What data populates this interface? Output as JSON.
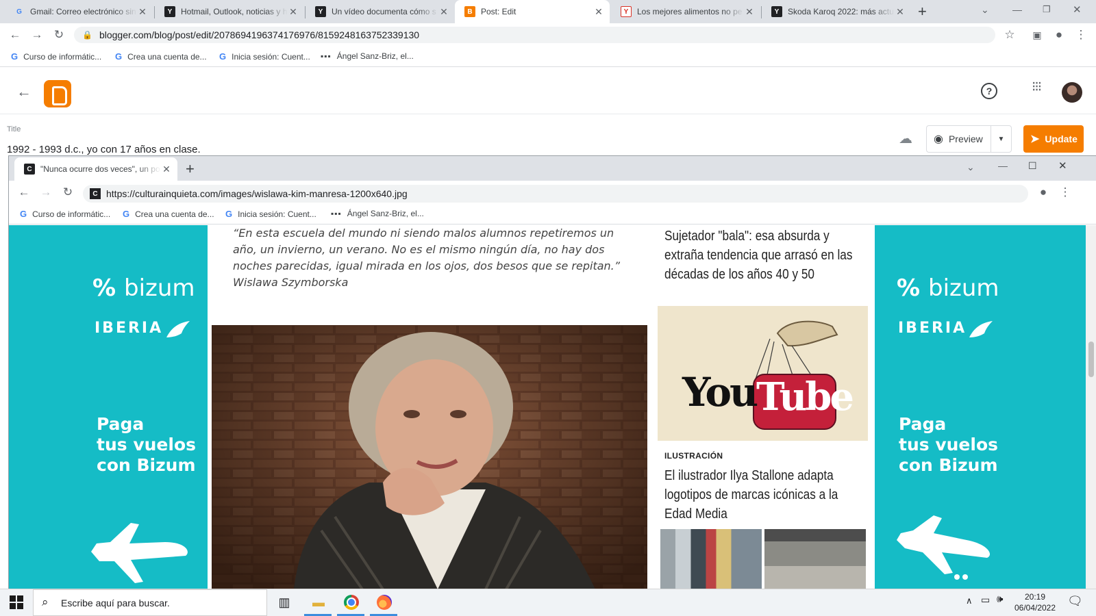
{
  "outer_browser": {
    "tabs": [
      {
        "title": "Gmail: Correo electrónico sin",
        "favicon": "google-g-icon"
      },
      {
        "title": "Hotmail, Outlook, noticias y h",
        "favicon": "y-icon"
      },
      {
        "title": "Un vídeo documenta cómo s",
        "favicon": "y-icon"
      },
      {
        "title": "Post: Edit",
        "favicon": "blogger-icon"
      },
      {
        "title": "Los mejores alimentos no pe",
        "favicon": "y-red-icon"
      },
      {
        "title": "Skoda Karoq 2022: más actua",
        "favicon": "y-icon"
      }
    ],
    "url": "blogger.com/blog/post/edit/2078694196374176976/8159248163752339130",
    "bookmarks": [
      "Curso de informátic...",
      "Crea una cuenta de...",
      "Inicia sesión: Cuent...",
      "Ángel Sanz-Briz, el..."
    ]
  },
  "blogger": {
    "title_label": "Title",
    "title_value": "1992 - 1993 d.c., yo con 17 años en clase.",
    "preview_label": "Preview",
    "update_label": "Update",
    "brand_color": "#f57d00"
  },
  "inner_browser": {
    "tab_title": "\"Nunca ocurre dos veces\", un po",
    "url": "https://culturainquieta.com/images/wislawa-kim-manresa-1200x640.jpg",
    "bookmarks": [
      "Curso de informátic...",
      "Crea una cuenta de...",
      "Inicia sesión: Cuent...",
      "Ángel Sanz-Briz, el..."
    ]
  },
  "article": {
    "quote": "“En esta escuela del mundo ni siendo malos alumnos repetiremos un año, un invierno, un verano. No es el mismo ningún día, no hay dos noches parecidas, igual mirada en los ojos, dos besos que se repitan.” Wislawa Szymborska",
    "side_item_1_title": "Sujetador \"bala\": esa absurda y extraña tendencia que arrasó en las décadas de los años 40 y 50",
    "side_item_2_category": "ILUSTRACIÓN",
    "side_item_2_title": "El ilustrador Ilya Stallone adapta logotipos de marcas icónicas a la Edad Media",
    "youtube_logo_left": "You",
    "youtube_logo_right": "Tube"
  },
  "ad": {
    "brand": "bizum",
    "brand_mark": "%",
    "airline": "IBERIA",
    "slogan_lines": [
      "Paga",
      "tus vuelos",
      "con Bizum"
    ],
    "bg_color": "#15bcc6"
  },
  "taskbar": {
    "search_placeholder": "Escribe aquí para buscar.",
    "time": "20:19",
    "date": "06/04/2022"
  }
}
